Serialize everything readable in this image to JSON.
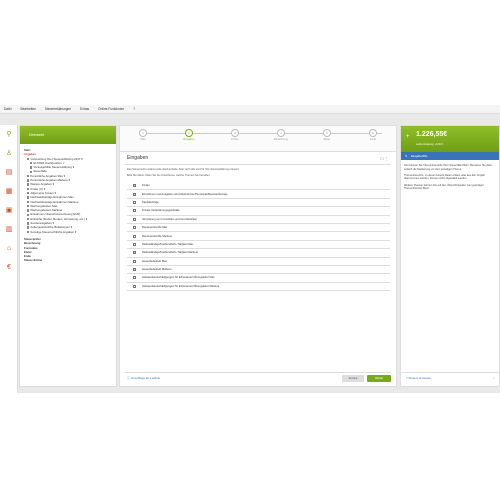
{
  "menu": [
    "Datei",
    "Bearbeiten",
    "Steuererklärungen",
    "Extras",
    "Online-Funktionen",
    "?"
  ],
  "sidebar_icons": [
    "search-icon",
    "people-icon",
    "document-icon",
    "receipt-icon",
    "money-icon",
    "chart-icon",
    "bank-icon",
    "euro-icon"
  ],
  "nav": {
    "title": "Übersicht",
    "items": [
      {
        "label": "Start",
        "style": "bold"
      },
      {
        "label": "Angaben",
        "style": "active"
      },
      {
        "label": "Vorbereitung Ihrer Steuererklärung 2017 ▾",
        "style": "check",
        "indent": 1
      },
      {
        "label": "ELSTER-Konfiguration ✓",
        "style": "check",
        "indent": 2
      },
      {
        "label": "Vorausgefüllte Steuererklärung ▾",
        "style": "check",
        "indent": 2
      },
      {
        "label": "Steuerfälle",
        "style": "check",
        "indent": 2
      },
      {
        "label": "Persönliche Angaben Max ▾",
        "style": "check",
        "indent": 1
      },
      {
        "label": "Persönliche Angaben Marlene ▾",
        "style": "check",
        "indent": 1
      },
      {
        "label": "Weitere Angaben ▾",
        "style": "check",
        "indent": 1
      },
      {
        "label": "Kinder (0) ▾",
        "style": "check",
        "indent": 1
      },
      {
        "label": "Allgemeine Kosten ▾",
        "style": "check",
        "indent": 1
      },
      {
        "label": "Nachweisbeiträge Einnahmen Max",
        "style": "check",
        "indent": 1
      },
      {
        "label": "Nachweisbeiträge Einnahmen Marlene",
        "style": "check",
        "indent": 1
      },
      {
        "label": "Werbungskosten Max",
        "style": "check",
        "indent": 1
      },
      {
        "label": "Werbungskosten Marlene",
        "style": "check",
        "indent": 1
      },
      {
        "label": "Einnahmen Überschussrechnung (EÜR)",
        "style": "check",
        "indent": 1
      },
      {
        "label": "Einkünfte (Kinder, Renten, Vermietung, etc.) ▾",
        "style": "check",
        "indent": 1
      },
      {
        "label": "Sonderausgaben ▾",
        "style": "check",
        "indent": 1
      },
      {
        "label": "Außergewöhnliche Belastungen ▾",
        "style": "check",
        "indent": 1
      },
      {
        "label": "Sonstige Steuerrechtliche Angaben ▾",
        "style": "check",
        "indent": 1
      },
      {
        "label": "Steuerprüfer",
        "style": "bold"
      },
      {
        "label": "Berechnung",
        "style": "bold"
      },
      {
        "label": "Formulare",
        "style": "bold"
      },
      {
        "label": "Elster",
        "style": "bold"
      },
      {
        "label": "Ende",
        "style": "bold"
      },
      {
        "label": "Steuer-Extras",
        "style": "bold"
      }
    ]
  },
  "steps": [
    {
      "num": "1",
      "label": "Start",
      "active": false
    },
    {
      "num": "2",
      "label": "Eingaben",
      "active": true
    },
    {
      "num": "3",
      "label": "Prüfen",
      "active": false
    },
    {
      "num": "4",
      "label": "Berechnung",
      "active": false
    },
    {
      "num": "5",
      "label": "Elster",
      "active": false
    },
    {
      "num": "6",
      "label": "Ende",
      "active": false
    }
  ],
  "main": {
    "title": "Eingaben",
    "tools": "☐ ⋮",
    "intro1": "Das Steuerrecht umfasst viele Sachverhalte. Aber nicht alle sind für Ihre Steuererklärung relevant.",
    "intro2": "Bitte Sie daher, bitten Sie bei Unterthema, welche Themen Sie betreffen.",
    "rows": [
      {
        "label": "Kinder",
        "checked": true
      },
      {
        "label": "Einnahmen und Ausgaben als Arbeitnehmer/Pensionär/Beamtenbezüge",
        "checked": true
      },
      {
        "label": "Kapitalerträge",
        "checked": false
      },
      {
        "label": "Private Veräußerungsgeschäfte",
        "checked": false
      },
      {
        "label": "Vermietung von Immobilien und Grundstücken",
        "checked": false
      },
      {
        "label": "Renteneinkünfte Max",
        "checked": false
      },
      {
        "label": "Renteneinkünfte Marlene",
        "checked": false
      },
      {
        "label": "Selbstständige/Freiberufliche Tätigkeit Max",
        "checked": false
      },
      {
        "label": "Selbstständige/Freiberufliche Tätigkeit Marlene",
        "checked": true
      },
      {
        "label": "Gewerbebetrieb Max",
        "checked": false
      },
      {
        "label": "Gewerbebetrieb Marlene",
        "checked": true
      },
      {
        "label": "Aufwandsentschädigungen für Ehrenämter/Übungsleiter Max",
        "checked": false
      },
      {
        "label": "Aufwandsentschädigungen für Ehrenämter/Übungsleiter Marlene",
        "checked": false
      }
    ],
    "link_label": "ⓘ Vorschläge als Leitlinie",
    "back_label": "Zurück",
    "next_label": "Weiter"
  },
  "refund": {
    "amount": "1.226,55€",
    "sub": "Letzte Änderung: +0,00 €"
  },
  "help": {
    "title": "Eingabehilfe",
    "p1": "Hier können Sie Themenbereiche Ihrer Steuerfälle filtern. Benutzen Sie dazu einfach die Markierung vor dem jeweiligen Thema.",
    "p2": "Themenbereiche, zu denen bereits Daten erfasst oder aus den Vorjahr übernommen wurden, können nicht abgewählt werden.",
    "p3": "Weitere Themen können Sie auf den Übersichtsseiten zum jeweiligen Themenbereich filtern.",
    "link": "Weitere Hinweise",
    "arrow": "›"
  },
  "colors": {
    "accent": "#7aa91b",
    "active": "#d2451e",
    "link": "#3a74b8"
  }
}
